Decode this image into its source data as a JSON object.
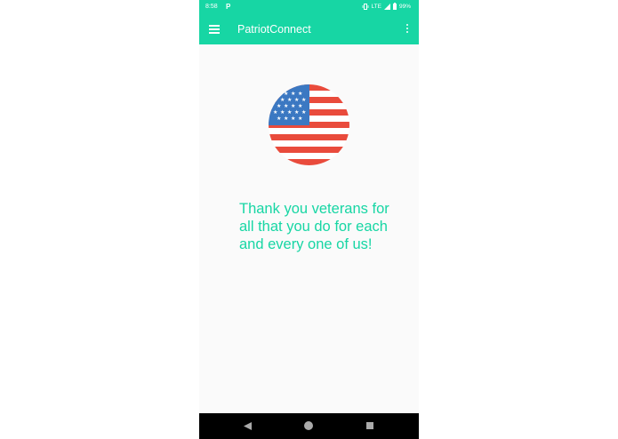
{
  "status_bar": {
    "time": "8:58",
    "notification": "P",
    "network": "LTE",
    "battery": "99%"
  },
  "app_bar": {
    "title": "PatriotConnect",
    "menu_icon": "hamburger-menu-icon",
    "overflow_icon": "more-vert-icon"
  },
  "main": {
    "image": "american-flag-circle",
    "message": "Thank you veterans for all that you do for each and every one of us!"
  },
  "nav_bar": {
    "back_icon": "back-triangle-icon",
    "home_icon": "home-circle-icon",
    "recents_icon": "recents-square-icon"
  },
  "colors": {
    "accent": "#17d6a4",
    "flag_red": "#e94b3c",
    "flag_blue": "#3b78c2",
    "background": "#fafafa"
  }
}
